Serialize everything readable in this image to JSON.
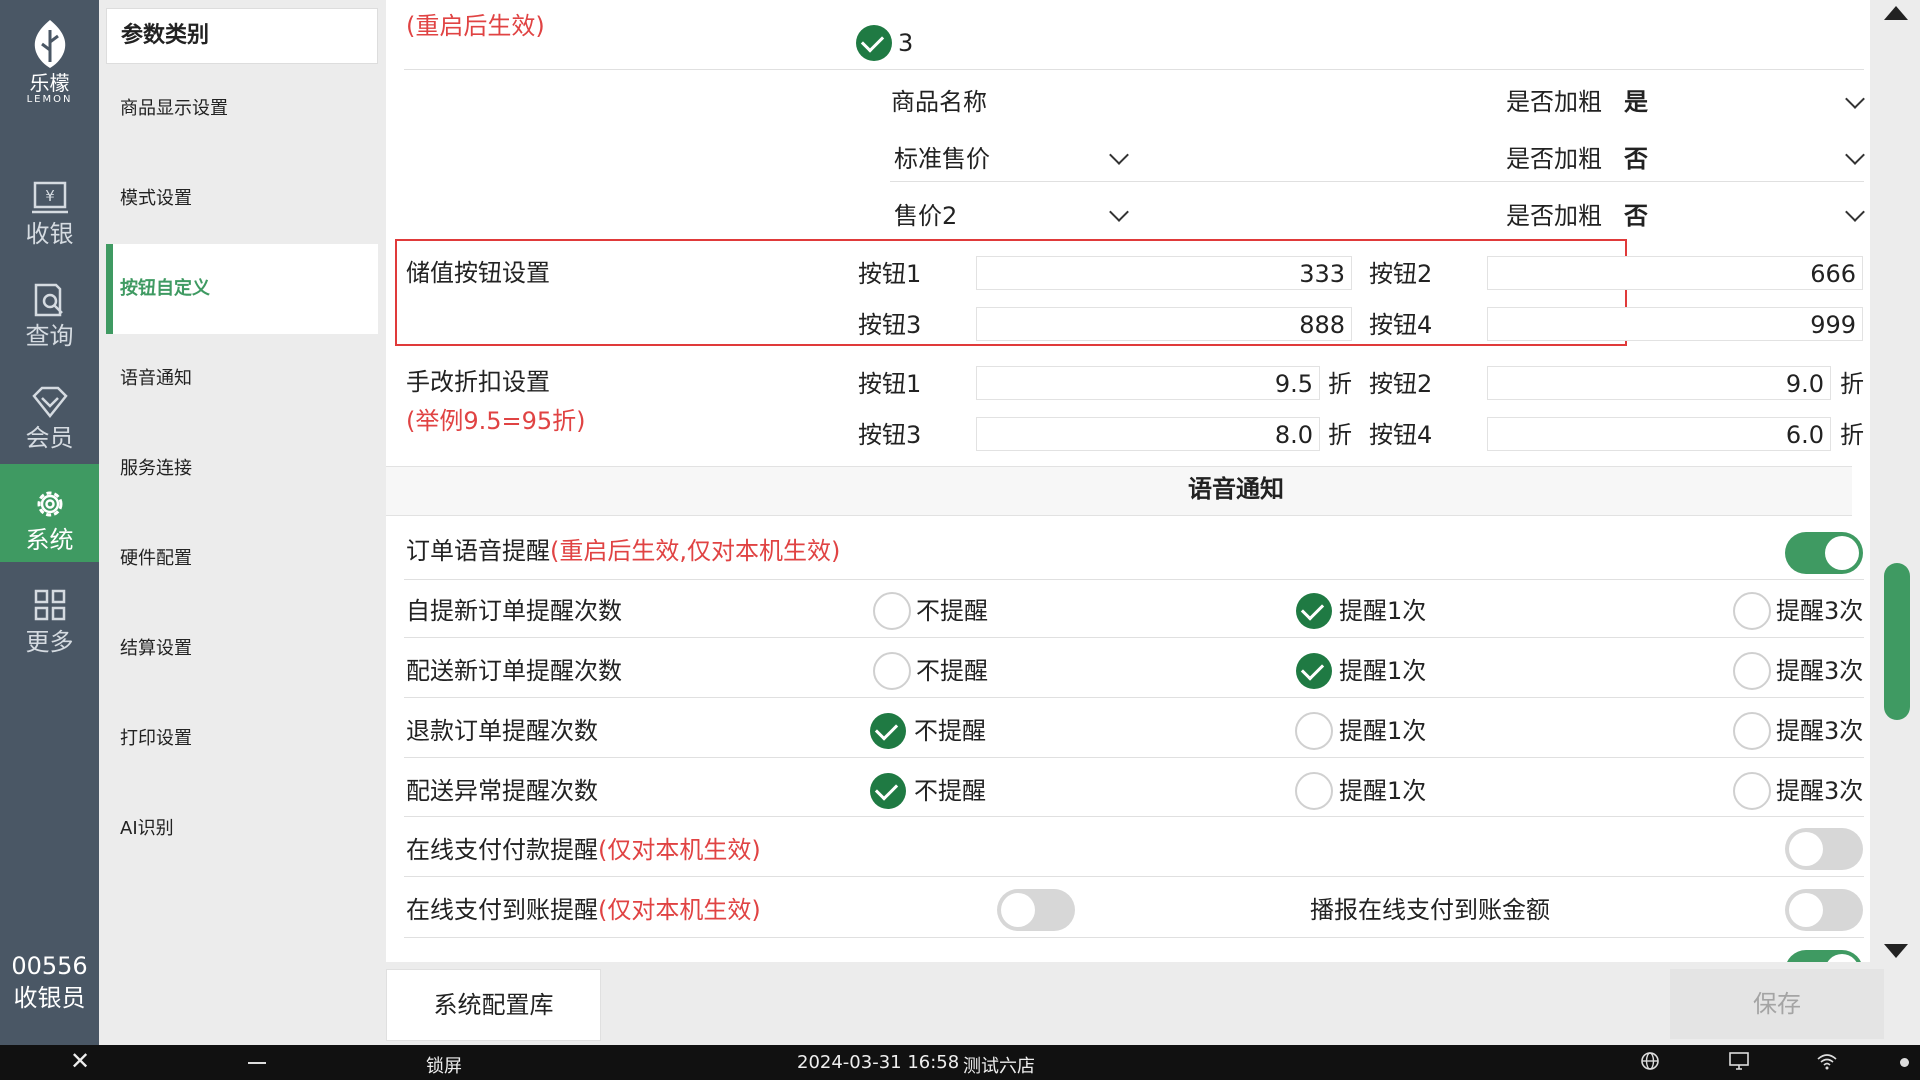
{
  "logo": {
    "name": "乐檬",
    "sub": "LEMON"
  },
  "nav": [
    {
      "label": "收银",
      "icon": "cashier-icon"
    },
    {
      "label": "查询",
      "icon": "query-icon"
    },
    {
      "label": "会员",
      "icon": "member-icon"
    },
    {
      "label": "系统",
      "icon": "gear-icon",
      "active": true
    },
    {
      "label": "更多",
      "icon": "grid-icon"
    }
  ],
  "user": {
    "id": "00556",
    "role": "收银员"
  },
  "categories": {
    "title": "参数类别",
    "items": [
      "商品显示设置",
      "模式设置",
      "按钮自定义",
      "语音通知",
      "服务连接",
      "硬件配置",
      "结算设置",
      "打印设置",
      "AI识别"
    ],
    "active": "按钮自定义"
  },
  "top": {
    "restart_note": "(重启后生效)",
    "selected_option": "3",
    "field_rows": [
      {
        "field": "商品名称",
        "bold_label": "是否加粗",
        "bold_value": "是"
      },
      {
        "field": "标准售价",
        "bold_label": "是否加粗",
        "bold_value": "否"
      },
      {
        "field": "售价2",
        "bold_label": "是否加粗",
        "bold_value": "否"
      }
    ]
  },
  "stored_value": {
    "title": "储值按钮设置",
    "buttons": [
      {
        "label": "按钮1",
        "value": "333"
      },
      {
        "label": "按钮2",
        "value": "666"
      },
      {
        "label": "按钮3",
        "value": "888"
      },
      {
        "label": "按钮4",
        "value": "999"
      }
    ]
  },
  "discount": {
    "title": "手改折扣设置",
    "example": "(举例9.5=95折)",
    "unit": "折",
    "buttons": [
      {
        "label": "按钮1",
        "value": "9.5"
      },
      {
        "label": "按钮2",
        "value": "9.0"
      },
      {
        "label": "按钮3",
        "value": "8.0"
      },
      {
        "label": "按钮4",
        "value": "6.0"
      }
    ]
  },
  "voice": {
    "section_title": "语音通知",
    "order_voice": {
      "label": "订单语音提醒",
      "note": "(重启后生效,仅对本机生效)",
      "on": true
    },
    "options": [
      "不提醒",
      "提醒1次",
      "提醒3次"
    ],
    "count_rows": [
      {
        "label": "自提新订单提醒次数",
        "selected": 1
      },
      {
        "label": "配送新订单提醒次数",
        "selected": 1
      },
      {
        "label": "退款订单提醒次数",
        "selected": 0
      },
      {
        "label": "配送异常提醒次数",
        "selected": 0
      }
    ],
    "online_pay_remind": {
      "label": "在线支付付款提醒",
      "note": "(仅对本机生效)",
      "on": false
    },
    "online_arrive_remind": {
      "label": "在线支付到账提醒",
      "note": "(仅对本机生效)",
      "on": false
    },
    "broadcast_amount": {
      "label": "播报在线支付到账金额",
      "on": false
    }
  },
  "footer": {
    "config_lib": "系统配置库",
    "save": "保存"
  },
  "taskbar": {
    "lock": "锁屏",
    "datetime": "2024-03-31 16:58",
    "store": "测试六店"
  },
  "colors": {
    "accent": "#3f9a62",
    "nav_bg": "#4a5765",
    "red": "#e04343",
    "check": "#1f7a43"
  }
}
